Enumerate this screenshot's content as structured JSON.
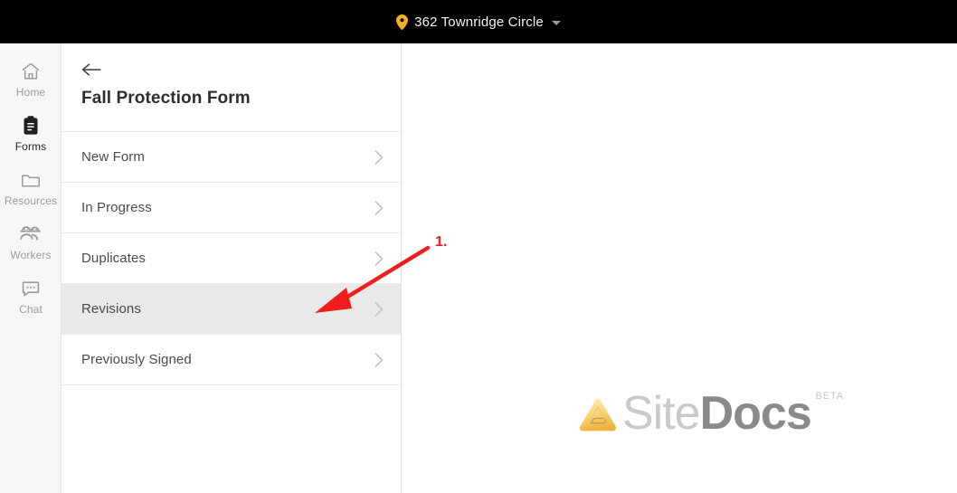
{
  "topbar": {
    "site_name": "362 Townridge Circle",
    "pin_icon": "location-pin-icon",
    "caret_icon": "chevron-down-icon",
    "background": "#000000",
    "pin_color": "#f4b223"
  },
  "sidebar": {
    "items": [
      {
        "label": "Home",
        "icon": "home-icon",
        "active": false
      },
      {
        "label": "Forms",
        "icon": "clipboard-icon",
        "active": true
      },
      {
        "label": "Resources",
        "icon": "folder-icon",
        "active": false
      },
      {
        "label": "Workers",
        "icon": "workers-icon",
        "active": false
      },
      {
        "label": "Chat",
        "icon": "chat-bubble-icon",
        "active": false
      }
    ]
  },
  "panel": {
    "back_icon": "back-arrow-icon",
    "title": "Fall Protection Form",
    "rows": [
      {
        "label": "New Form",
        "highlighted": false
      },
      {
        "label": "In Progress",
        "highlighted": false
      },
      {
        "label": "Duplicates",
        "highlighted": false
      },
      {
        "label": "Revisions",
        "highlighted": true
      },
      {
        "label": "Previously Signed",
        "highlighted": false
      }
    ],
    "chevron_icon": "chevron-right-icon",
    "highlight_color": "#e9e9e9"
  },
  "brand": {
    "mark": "sitedocs-triangle-logo",
    "word_light": "Site",
    "word_bold": "Docs",
    "beta": "BETA",
    "mark_color": "#f6c85a"
  },
  "annotation": {
    "step_label": "1.",
    "color": "#ef1d1d",
    "points_to": "Revisions"
  }
}
